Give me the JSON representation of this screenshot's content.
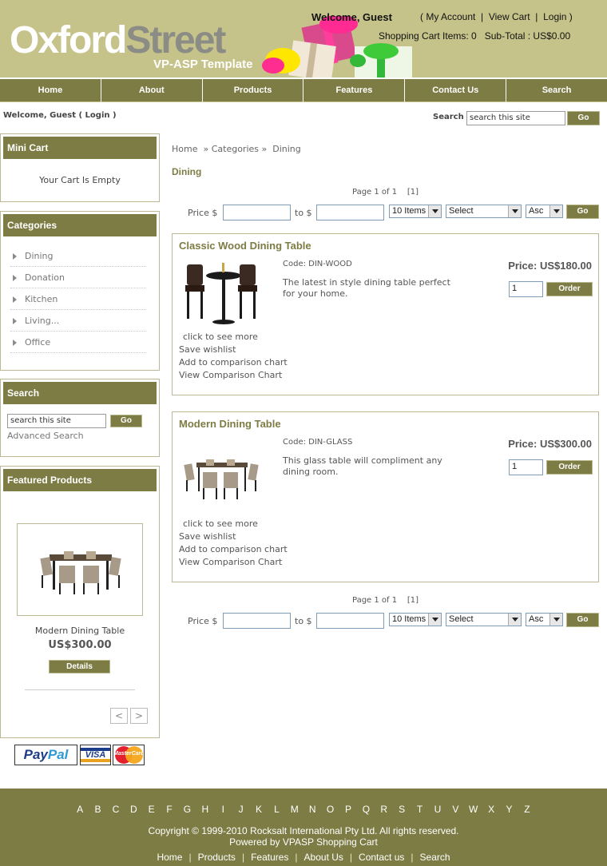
{
  "header": {
    "logo_part1": "Oxford",
    "logo_part2": "Street",
    "logo_subtitle": "VP-ASP Template",
    "welcome": "Welcome, Guest",
    "links": [
      "( My Account",
      "View Cart",
      "Login )"
    ],
    "link_separator": "|",
    "cart_summary": "Shopping Cart Items: 0   Sub-Total : US$0.00"
  },
  "nav": [
    "Home",
    "About",
    "Products",
    "Features",
    "Contact Us",
    "Search"
  ],
  "welcome_bar": {
    "text": "Welcome, Guest ( Login )",
    "search_label": "Search",
    "search_placeholder": "search this site",
    "go_label": "Go"
  },
  "sidebar": {
    "mini_cart": {
      "title": "Mini Cart",
      "empty_text": "Your Cart Is Empty"
    },
    "categories": {
      "title": "Categories",
      "items": [
        "Dining",
        "Donation",
        "Kitchen",
        "Living...",
        "Office"
      ]
    },
    "search": {
      "title": "Search",
      "placeholder": "search this site",
      "go_label": "Go",
      "advanced": "Advanced Search"
    },
    "featured": {
      "title": "Featured Products",
      "name": "Modern Dining Table",
      "price": "US$300.00",
      "details_label": "Details",
      "prev": "<",
      "next": ">"
    }
  },
  "payment": {
    "paypal_a": "Pay",
    "paypal_b": "Pal",
    "visa": "VISA",
    "mastercard": "MasterCard"
  },
  "main": {
    "breadcrumb": [
      "Home",
      "Categories",
      "Dining"
    ],
    "breadcrumb_sep": "»",
    "title": "Dining",
    "page_info": "Page 1 of 1    [1]",
    "pricebar": {
      "price_label": "Price $",
      "to_label": "to $",
      "items_select": "10 Items",
      "sort_select": "Select",
      "order_select": "Asc",
      "go_label": "Go"
    },
    "products": [
      {
        "name": "Classic Wood Dining Table",
        "code": "Code: DIN-WOOD",
        "desc": "The latest in style dining table perfect for your home.",
        "price": "Price: US$180.00",
        "qty": "1",
        "order_label": "Order",
        "links": [
          "click to see more",
          "Save wishlist",
          "Add to comparison chart",
          "View Comparison Chart"
        ]
      },
      {
        "name": "Modern Dining Table",
        "code": "Code: DIN-GLASS",
        "desc": "This glass table will compliment any dining room.",
        "price": "Price: US$300.00",
        "qty": "1",
        "order_label": "Order",
        "links": [
          "click to see more",
          "Save wishlist",
          "Add to comparison chart",
          "View Comparison Chart"
        ]
      }
    ]
  },
  "footer": {
    "alphabet": [
      "A",
      "B",
      "C",
      "D",
      "E",
      "F",
      "G",
      "H",
      "I",
      "J",
      "K",
      "L",
      "M",
      "N",
      "O",
      "P",
      "Q",
      "R",
      "S",
      "T",
      "U",
      "V",
      "W",
      "X",
      "Y",
      "Z"
    ],
    "copyright": "Copyright © 1999-2010 Rocksalt International Pty Ltd. All rights reserved.",
    "powered": "Powered by VPASP Shopping Cart",
    "links": [
      "Home",
      "Products",
      "Features",
      "About Us",
      "Contact us",
      "Search"
    ],
    "link_separator": "|"
  },
  "colors": {
    "header_bg": "#c6c38a",
    "accent": "#7d7c44",
    "border": "#bbb893"
  }
}
